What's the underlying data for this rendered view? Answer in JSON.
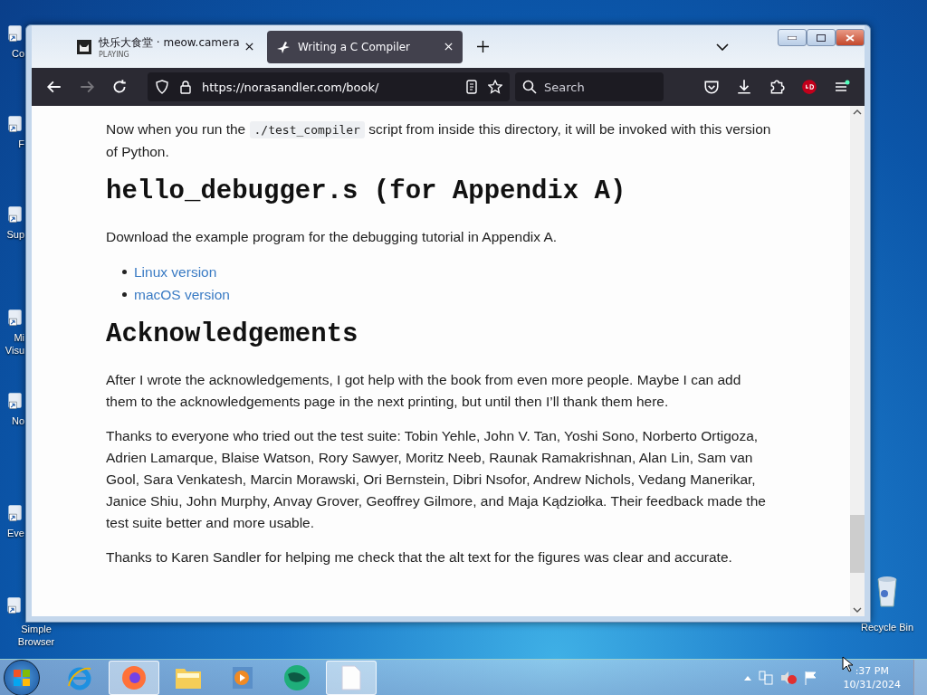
{
  "desktop": {
    "icons": [
      {
        "label": "Co"
      },
      {
        "label": "F"
      },
      {
        "label": "Sup"
      },
      {
        "label": "Mi\nVisu"
      },
      {
        "label": "No"
      },
      {
        "label": "Eve"
      },
      {
        "label": "Simple\nBrowser"
      },
      {
        "label": "Recycle Bin"
      }
    ]
  },
  "browser": {
    "tabs": [
      {
        "title": "快乐大食堂 · meow.camera",
        "subtitle": "PLAYING",
        "selected": false
      },
      {
        "title": "Writing a C Compiler",
        "selected": true
      }
    ],
    "url": "https://norasandler.com/book/",
    "search": {
      "placeholder": "Search"
    }
  },
  "page": {
    "blocks": [
      {
        "kind": "paragraph",
        "parts": [
          {
            "kind": "text",
            "text": "Now when you run the "
          },
          {
            "kind": "code",
            "text": "./test_compiler"
          },
          {
            "kind": "text",
            "text": " script from inside this directory, it will be invoked with this version of Python."
          }
        ]
      },
      {
        "kind": "heading",
        "text": "hello_debugger.s (for Appendix A)"
      },
      {
        "kind": "paragraph",
        "parts": [
          {
            "kind": "text",
            "text": "Download the example program for the debugging tutorial in Appendix A."
          }
        ]
      },
      {
        "kind": "list",
        "items": [
          "Linux version",
          "macOS version"
        ]
      },
      {
        "kind": "heading",
        "text": "Acknowledgements"
      },
      {
        "kind": "paragraph",
        "parts": [
          {
            "kind": "text",
            "text": "After I wrote the acknowledgements, I got help with the book from even more people. Maybe I can add them to the acknowledgements page in the next printing, but until then I’ll thank them here."
          }
        ]
      },
      {
        "kind": "paragraph",
        "parts": [
          {
            "kind": "text",
            "text": "Thanks to everyone who tried out the test suite: Tobin Yehle, John V. Tan, Yoshi Sono, Norberto Ortigoza, Adrien Lamarque, Blaise Watson, Rory Sawyer, Moritz Neeb, Raunak Ramakrishnan, Alan Lin, Sam van Gool, Sara Venkatesh, Marcin Morawski, Ori Bernstein, Dibri Nsofor, Andrew Nichols, Vedang Manerikar, Janice Shiu, John Murphy, Anvay Grover, Geoffrey Gilmore, and Maja Kądziołka. Their feedback made the test suite better and more usable."
          }
        ]
      },
      {
        "kind": "paragraph",
        "parts": [
          {
            "kind": "text",
            "text": "Thanks to Karen Sandler for helping me check that the alt text for the figures was clear and accurate."
          }
        ]
      }
    ]
  },
  "taskbar": {
    "items": [
      {
        "kind": "ie",
        "selected": false
      },
      {
        "kind": "firefox",
        "selected": true
      },
      {
        "kind": "folder",
        "selected": false
      },
      {
        "kind": "media",
        "selected": false
      },
      {
        "kind": "globe",
        "selected": false
      },
      {
        "kind": "document",
        "selected": true
      }
    ],
    "clock": {
      "time": ":37 PM",
      "date": "10/31/2024"
    }
  }
}
